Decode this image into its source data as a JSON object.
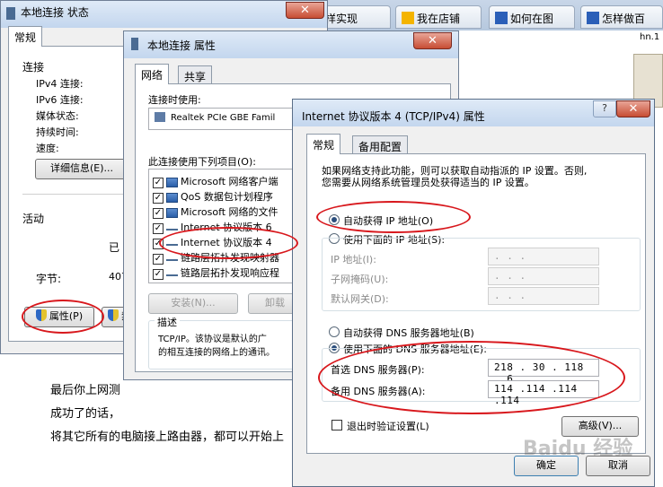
{
  "browser": {
    "tabs": [
      {
        "label": "样实现"
      },
      {
        "label": "我在店铺"
      },
      {
        "label": "如何在图"
      },
      {
        "label": "怎样做百"
      }
    ],
    "corner_text": "hn.1"
  },
  "article": {
    "lines": [
      "最后你上网测",
      "成功了的话，",
      "将其它所有的电脑接上路由器，都可以开始上"
    ]
  },
  "status_window": {
    "title": "本地连接 状态",
    "tab": "常规",
    "connection_section": "连接",
    "rows": [
      {
        "label": "IPv4 连接:"
      },
      {
        "label": "IPv6 连接:"
      },
      {
        "label": "媒体状态:"
      },
      {
        "label": "持续时间:"
      },
      {
        "label": "速度:"
      }
    ],
    "details_button": "详细信息(E)...",
    "activity_section": "活动",
    "sent_partial": "已",
    "bytes_label": "字节:",
    "bytes_partial": "407",
    "properties_button": "属性(P)",
    "second_button": "禁"
  },
  "props_window": {
    "title": "本地连接 属性",
    "tabs": [
      "网络",
      "共享"
    ],
    "connect_using_label": "连接时使用:",
    "adapter": "Realtek PCIe GBE Famil",
    "items_label": "此连接使用下列项目(O):",
    "items": [
      {
        "label": "Microsoft 网络客户端"
      },
      {
        "label": "QoS 数据包计划程序"
      },
      {
        "label": "Microsoft 网络的文件"
      },
      {
        "label": "Internet 协议版本 6"
      },
      {
        "label": "Internet 协议版本 4"
      },
      {
        "label": "链路层拓扑发现映射器"
      },
      {
        "label": "链路层拓扑发现响应程"
      }
    ],
    "install_button": "安装(N)...",
    "uninstall_button": "卸载",
    "description_label": "描述",
    "description_lines": [
      "TCP/IP。该协议是默认的广",
      "的相互连接的网络上的通讯。"
    ]
  },
  "ipv4_window": {
    "title": "Internet 协议版本 4 (TCP/IPv4) 属性",
    "tabs": [
      "常规",
      "备用配置"
    ],
    "intro_lines": [
      "如果网络支持此功能，则可以获取自动指派的 IP 设置。否则,",
      "您需要从网络系统管理员处获得适当的 IP 设置。"
    ],
    "auto_ip_label": "自动获得 IP 地址(O)",
    "manual_ip_label": "使用下面的 IP 地址(S):",
    "ip_address_label": "IP 地址(I):",
    "subnet_label": "子网掩码(U):",
    "gateway_label": "默认网关(D):",
    "empty_ip": ".     .     .",
    "auto_dns_label": "自动获得 DNS 服务器地址(B)",
    "manual_dns_label": "使用下面的 DNS 服务器地址(E):",
    "preferred_dns_label": "首选 DNS 服务器(P):",
    "preferred_dns_value": "218 . 30 . 118 . 6",
    "alternate_dns_label": "备用 DNS 服务器(A):",
    "alternate_dns_value": "114 .114 .114 .114",
    "validate_label": "退出时验证设置(L)",
    "advanced_button": "高级(V)...",
    "ok_button": "确定",
    "cancel_button": "取消"
  },
  "watermark": "Baidu 经验"
}
